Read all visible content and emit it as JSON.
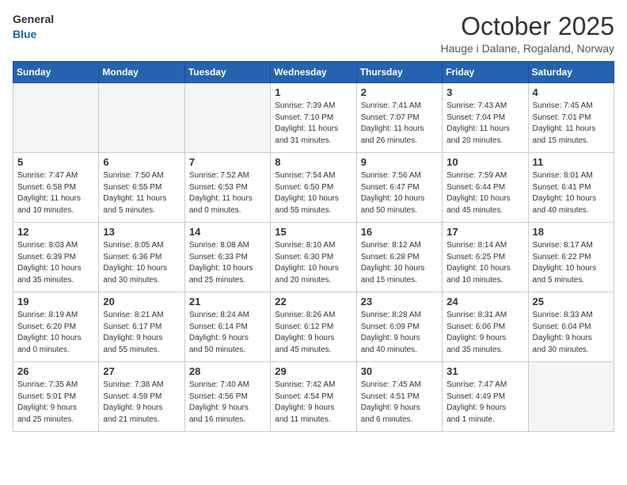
{
  "logo": {
    "line1": "General",
    "line2": "Blue"
  },
  "title": "October 2025",
  "subtitle": "Hauge i Dalane, Rogaland, Norway",
  "days_of_week": [
    "Sunday",
    "Monday",
    "Tuesday",
    "Wednesday",
    "Thursday",
    "Friday",
    "Saturday"
  ],
  "weeks": [
    [
      {
        "day": "",
        "info": ""
      },
      {
        "day": "",
        "info": ""
      },
      {
        "day": "",
        "info": ""
      },
      {
        "day": "1",
        "info": "Sunrise: 7:39 AM\nSunset: 7:10 PM\nDaylight: 11 hours\nand 31 minutes."
      },
      {
        "day": "2",
        "info": "Sunrise: 7:41 AM\nSunset: 7:07 PM\nDaylight: 11 hours\nand 26 minutes."
      },
      {
        "day": "3",
        "info": "Sunrise: 7:43 AM\nSunset: 7:04 PM\nDaylight: 11 hours\nand 20 minutes."
      },
      {
        "day": "4",
        "info": "Sunrise: 7:45 AM\nSunset: 7:01 PM\nDaylight: 11 hours\nand 15 minutes."
      }
    ],
    [
      {
        "day": "5",
        "info": "Sunrise: 7:47 AM\nSunset: 6:58 PM\nDaylight: 11 hours\nand 10 minutes."
      },
      {
        "day": "6",
        "info": "Sunrise: 7:50 AM\nSunset: 6:55 PM\nDaylight: 11 hours\nand 5 minutes."
      },
      {
        "day": "7",
        "info": "Sunrise: 7:52 AM\nSunset: 6:53 PM\nDaylight: 11 hours\nand 0 minutes."
      },
      {
        "day": "8",
        "info": "Sunrise: 7:54 AM\nSunset: 6:50 PM\nDaylight: 10 hours\nand 55 minutes."
      },
      {
        "day": "9",
        "info": "Sunrise: 7:56 AM\nSunset: 6:47 PM\nDaylight: 10 hours\nand 50 minutes."
      },
      {
        "day": "10",
        "info": "Sunrise: 7:59 AM\nSunset: 6:44 PM\nDaylight: 10 hours\nand 45 minutes."
      },
      {
        "day": "11",
        "info": "Sunrise: 8:01 AM\nSunset: 6:41 PM\nDaylight: 10 hours\nand 40 minutes."
      }
    ],
    [
      {
        "day": "12",
        "info": "Sunrise: 8:03 AM\nSunset: 6:39 PM\nDaylight: 10 hours\nand 35 minutes."
      },
      {
        "day": "13",
        "info": "Sunrise: 8:05 AM\nSunset: 6:36 PM\nDaylight: 10 hours\nand 30 minutes."
      },
      {
        "day": "14",
        "info": "Sunrise: 8:08 AM\nSunset: 6:33 PM\nDaylight: 10 hours\nand 25 minutes."
      },
      {
        "day": "15",
        "info": "Sunrise: 8:10 AM\nSunset: 6:30 PM\nDaylight: 10 hours\nand 20 minutes."
      },
      {
        "day": "16",
        "info": "Sunrise: 8:12 AM\nSunset: 6:28 PM\nDaylight: 10 hours\nand 15 minutes."
      },
      {
        "day": "17",
        "info": "Sunrise: 8:14 AM\nSunset: 6:25 PM\nDaylight: 10 hours\nand 10 minutes."
      },
      {
        "day": "18",
        "info": "Sunrise: 8:17 AM\nSunset: 6:22 PM\nDaylight: 10 hours\nand 5 minutes."
      }
    ],
    [
      {
        "day": "19",
        "info": "Sunrise: 8:19 AM\nSunset: 6:20 PM\nDaylight: 10 hours\nand 0 minutes."
      },
      {
        "day": "20",
        "info": "Sunrise: 8:21 AM\nSunset: 6:17 PM\nDaylight: 9 hours\nand 55 minutes."
      },
      {
        "day": "21",
        "info": "Sunrise: 8:24 AM\nSunset: 6:14 PM\nDaylight: 9 hours\nand 50 minutes."
      },
      {
        "day": "22",
        "info": "Sunrise: 8:26 AM\nSunset: 6:12 PM\nDaylight: 9 hours\nand 45 minutes."
      },
      {
        "day": "23",
        "info": "Sunrise: 8:28 AM\nSunset: 6:09 PM\nDaylight: 9 hours\nand 40 minutes."
      },
      {
        "day": "24",
        "info": "Sunrise: 8:31 AM\nSunset: 6:06 PM\nDaylight: 9 hours\nand 35 minutes."
      },
      {
        "day": "25",
        "info": "Sunrise: 8:33 AM\nSunset: 6:04 PM\nDaylight: 9 hours\nand 30 minutes."
      }
    ],
    [
      {
        "day": "26",
        "info": "Sunrise: 7:35 AM\nSunset: 5:01 PM\nDaylight: 9 hours\nand 25 minutes."
      },
      {
        "day": "27",
        "info": "Sunrise: 7:38 AM\nSunset: 4:59 PM\nDaylight: 9 hours\nand 21 minutes."
      },
      {
        "day": "28",
        "info": "Sunrise: 7:40 AM\nSunset: 4:56 PM\nDaylight: 9 hours\nand 16 minutes."
      },
      {
        "day": "29",
        "info": "Sunrise: 7:42 AM\nSunset: 4:54 PM\nDaylight: 9 hours\nand 11 minutes."
      },
      {
        "day": "30",
        "info": "Sunrise: 7:45 AM\nSunset: 4:51 PM\nDaylight: 9 hours\nand 6 minutes."
      },
      {
        "day": "31",
        "info": "Sunrise: 7:47 AM\nSunset: 4:49 PM\nDaylight: 9 hours\nand 1 minute."
      },
      {
        "day": "",
        "info": ""
      }
    ]
  ]
}
